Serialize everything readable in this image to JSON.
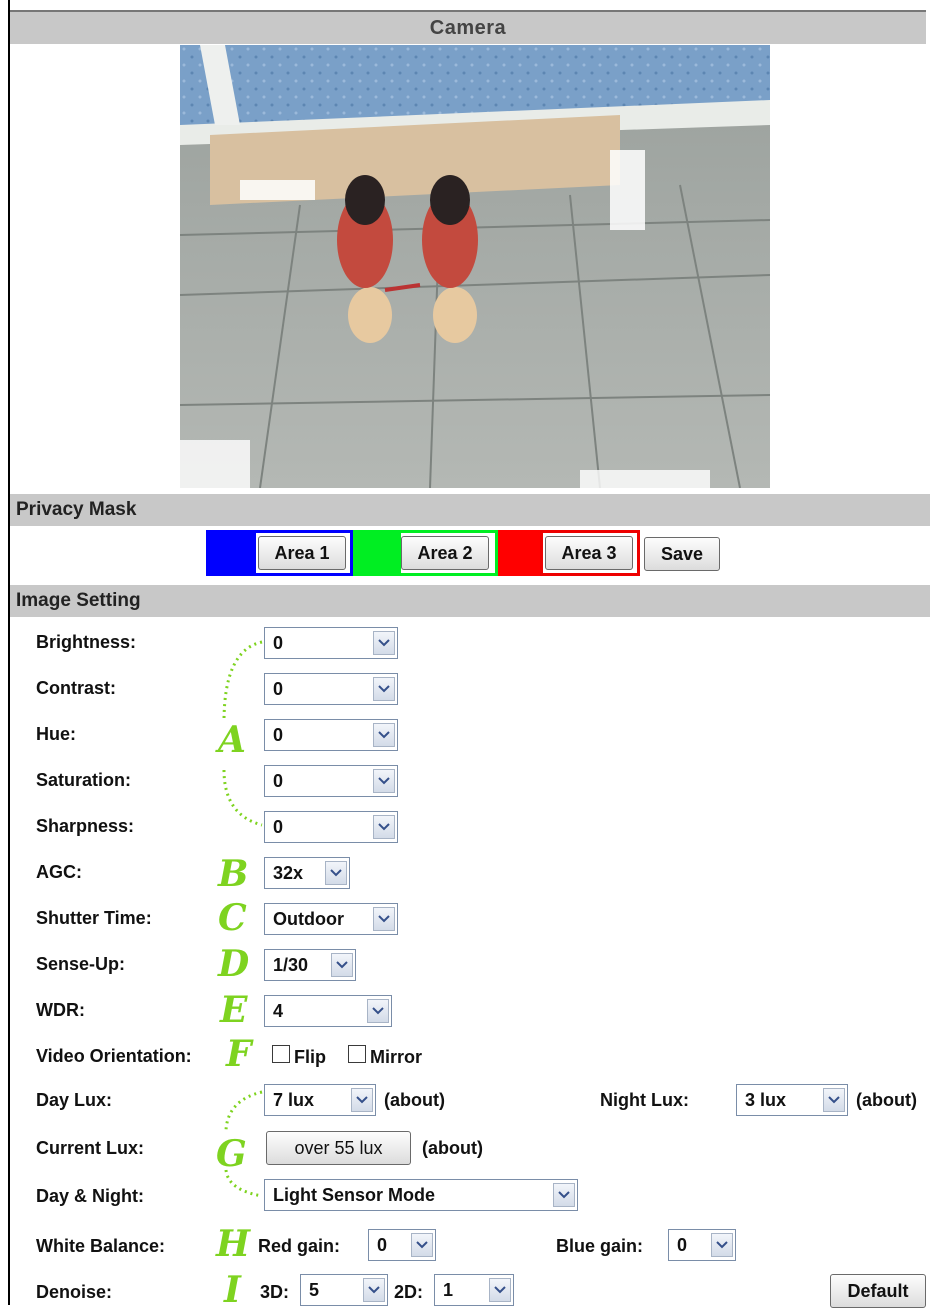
{
  "header": {
    "title": "Camera"
  },
  "sections": {
    "privacy_mask": "Privacy Mask",
    "image_setting": "Image Setting"
  },
  "privacy": {
    "area1": "Area 1",
    "area2": "Area 2",
    "area3": "Area 3",
    "save": "Save",
    "colors": {
      "area1": "#0000ff",
      "area2": "#00ee22",
      "area3": "#ff0000"
    }
  },
  "settings": {
    "brightness": {
      "label": "Brightness:",
      "value": "0"
    },
    "contrast": {
      "label": "Contrast:",
      "value": "0"
    },
    "hue": {
      "label": "Hue:",
      "value": "0"
    },
    "saturation": {
      "label": "Saturation:",
      "value": "0"
    },
    "sharpness": {
      "label": "Sharpness:",
      "value": "0"
    },
    "agc": {
      "label": "AGC:",
      "value": "32x"
    },
    "shutter": {
      "label": "Shutter Time:",
      "value": "Outdoor"
    },
    "senseup": {
      "label": "Sense-Up:",
      "value": "1/30"
    },
    "wdr": {
      "label": "WDR:",
      "value": "4"
    },
    "orientation": {
      "label": "Video Orientation:",
      "flip": "Flip",
      "mirror": "Mirror"
    },
    "daylux": {
      "label": "Day Lux:",
      "value": "7 lux",
      "suffix": "(about)"
    },
    "nightlux": {
      "label": "Night Lux:",
      "value": "3 lux",
      "suffix": "(about)"
    },
    "currentlux": {
      "label": "Current Lux:",
      "button": "over 55 lux",
      "suffix": "(about)"
    },
    "daynight": {
      "label": "Day & Night:",
      "value": "Light Sensor Mode"
    },
    "whitebalance": {
      "label": "White Balance:",
      "red_label": "Red gain:",
      "red_value": "0",
      "blue_label": "Blue gain:",
      "blue_value": "0"
    },
    "denoise": {
      "label": "Denoise:",
      "d3_label": "3D:",
      "d3_value": "5",
      "d2_label": "2D:",
      "d2_value": "1"
    },
    "default_button": "Default"
  },
  "annotations": {
    "a": "A",
    "b": "B",
    "c": "C",
    "d": "D",
    "e": "E",
    "f": "F",
    "g": "G",
    "h": "H",
    "i": "I",
    "color": "#7ed320"
  }
}
